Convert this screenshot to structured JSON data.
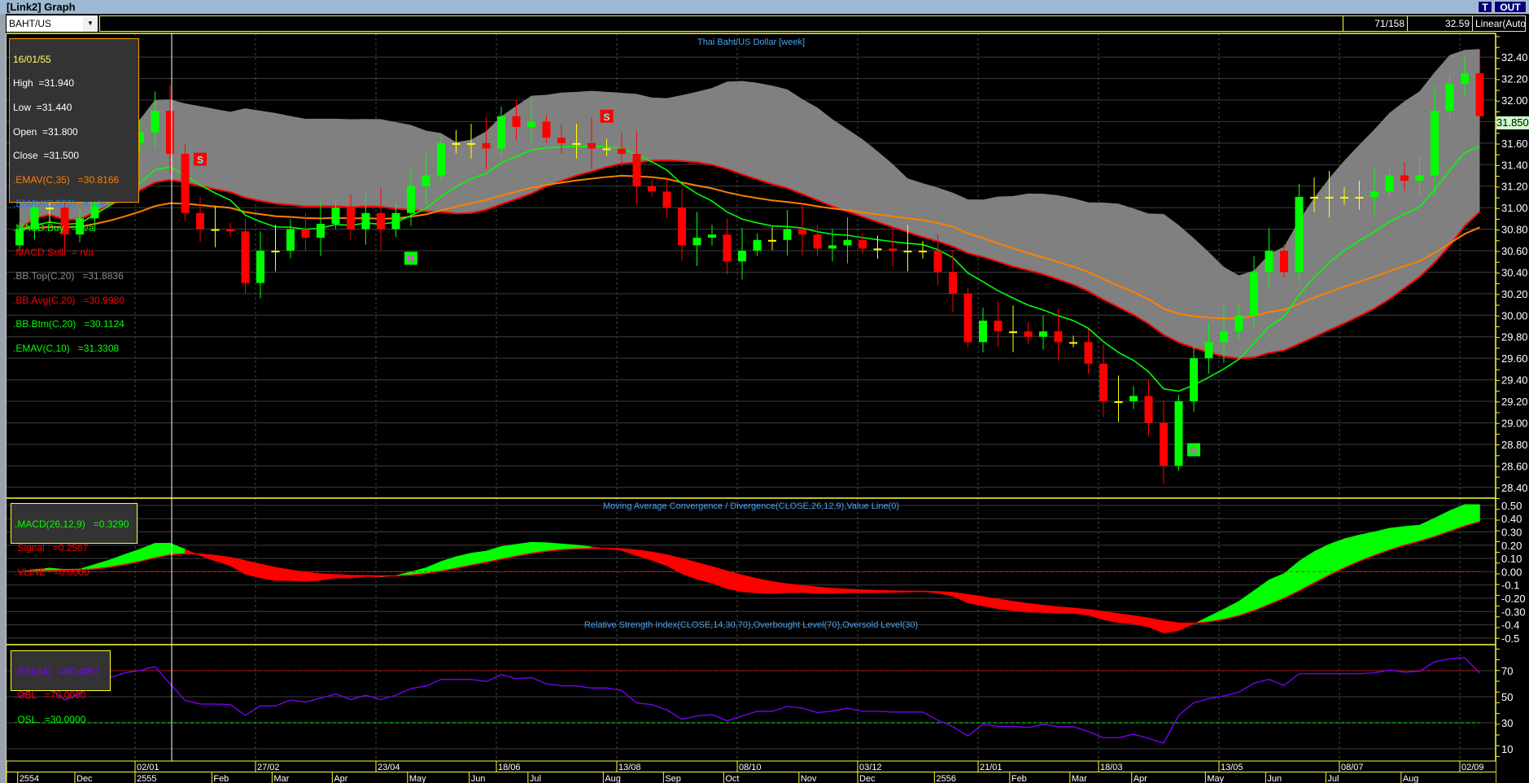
{
  "window": {
    "title": "[Link2] Graph",
    "t_button": "T",
    "out_button": "OUT"
  },
  "toolbar": {
    "symbol": "BAHT/US",
    "bar_count": "71/158",
    "last_value": "32.59",
    "scale_mode": "Linear(Auto"
  },
  "price_pane": {
    "title": "Thai Baht/US Dollar [week]",
    "current_price_label": "31.850",
    "legend": {
      "date": "16/01/55",
      "high": "High  =31.940",
      "low": "Low  =31.440",
      "open": "Open  =31.800",
      "close": "Close  =31.500",
      "emav35": ".EMAV(C,35)   =30.8166",
      "emav200": ".EMAV(C,200)   = n/a",
      "macd_buy": ".MACD.Buy   = n/a",
      "macd_sell": ".MACD.Sell   = n/a",
      "bb_top": ".BB.Top(C,20)   =31.8836",
      "bb_avg": ".BB.Avg(C,20)   =30.9980",
      "bb_btm": ".BB.Btm(C,20)   =30.1124",
      "emav10": ".EMAV(C,10)   =31.3308"
    }
  },
  "macd_pane": {
    "title": "Moving Average Convergence / Divergence(CLOSE,26,12,9),Value Line(0)",
    "legend": {
      "macd": ".MACD(26,12,9)   =0.3290",
      "signal": ".Signal   =0.2567",
      "vline": ".VLINE   =0.0000"
    }
  },
  "rsi_pane": {
    "title": "Relative Strength Index(CLOSE,14,30,70),Overbought Level(70),Oversold Level(30)",
    "legend": {
      "rsi": ".RSI(14)   =60.4057",
      "obl": ".OBL   =70.0000",
      "osl": ".OSL   =30.0000"
    }
  },
  "colors": {
    "up": "#00ff00",
    "down": "#ff0000",
    "doji": "#ffff00",
    "bb_fill": "#808080",
    "ema10": "#00ff00",
    "ema35": "#ff8000",
    "bb_avg": "#ff0000",
    "rsi": "#8000ff",
    "axis": "#ffff33",
    "title": "#4aa0f0"
  },
  "chart_data": {
    "type": "candlestick",
    "interval": "week",
    "cursor_index": 10,
    "first_open": 30.65,
    "closes": [
      30.8,
      31.0,
      31.0,
      30.75,
      30.9,
      31.3,
      31.4,
      31.6,
      31.7,
      31.9,
      31.5,
      30.95,
      30.8,
      30.8,
      30.78,
      30.3,
      30.6,
      30.6,
      30.8,
      30.72,
      30.85,
      31.0,
      30.8,
      30.95,
      30.8,
      30.95,
      31.2,
      31.3,
      31.6,
      31.6,
      31.6,
      31.55,
      31.85,
      31.75,
      31.8,
      31.65,
      31.6,
      31.6,
      31.55,
      31.55,
      31.5,
      31.2,
      31.15,
      31.0,
      30.65,
      30.72,
      30.75,
      30.5,
      30.6,
      30.7,
      30.7,
      30.8,
      30.75,
      30.62,
      30.65,
      30.7,
      30.62,
      30.62,
      30.6,
      30.6,
      30.6,
      30.4,
      30.2,
      29.75,
      29.95,
      29.85,
      29.85,
      29.8,
      29.85,
      29.75,
      29.75,
      29.55,
      29.2,
      29.2,
      29.25,
      29.0,
      28.6,
      29.2,
      29.6,
      29.75,
      29.85,
      30.0,
      30.4,
      30.6,
      30.4,
      31.1,
      31.1,
      31.1,
      31.1,
      31.1,
      31.15,
      31.3,
      31.25,
      31.3,
      31.9,
      32.15,
      32.25,
      31.85
    ],
    "cursor_candle": {
      "open": 31.8,
      "high": 31.94,
      "low": 31.44,
      "close": 31.5
    },
    "signals": [
      {
        "index": 12,
        "type": "S",
        "price": 31.45
      },
      {
        "index": 26,
        "type": "B",
        "price": 30.53
      },
      {
        "index": 39,
        "type": "S",
        "price": 31.85
      },
      {
        "index": 78,
        "type": "B",
        "price": 28.75
      }
    ],
    "price_axis": {
      "min": 28.3,
      "max": 32.62,
      "ticks": [
        "28.40",
        "28.60",
        "28.80",
        "29.00",
        "29.20",
        "29.40",
        "29.60",
        "29.80",
        "30.00",
        "30.20",
        "30.40",
        "30.60",
        "30.80",
        "31.00",
        "31.20",
        "31.40",
        "31.60",
        "31.80",
        "32.00",
        "32.20",
        "32.40"
      ]
    },
    "macd_axis": {
      "min": -0.55,
      "max": 0.555,
      "ticks": [
        "0.50",
        "0.40",
        "0.30",
        "0.20",
        "0.10",
        "0.00",
        "-0.1",
        "-0.20",
        "-0.30",
        "-0.4",
        "-0.5"
      ],
      "tick_values": [
        0.5,
        0.4,
        0.3,
        0.2,
        0.1,
        0,
        -0.1,
        -0.2,
        -0.3,
        -0.4,
        -0.5
      ]
    },
    "rsi_axis": {
      "min": 0.6,
      "max": 90,
      "ticks": [
        "70",
        "50",
        "30",
        "10"
      ],
      "tick_values": [
        70,
        50,
        30,
        10
      ],
      "overbought": 70,
      "oversold": 30
    },
    "date_labels": [
      {
        "label": "02/01",
        "week": 8
      },
      {
        "label": "27/02",
        "week": 16
      },
      {
        "label": "23/04",
        "week": 24
      },
      {
        "label": "18/06",
        "week": 32
      },
      {
        "label": "13/08",
        "week": 40
      },
      {
        "label": "08/10",
        "week": 48
      },
      {
        "label": "03/12",
        "week": 56
      },
      {
        "label": "21/01",
        "week": 64
      },
      {
        "label": "18/03",
        "week": 72
      },
      {
        "label": "13/05",
        "week": 80
      },
      {
        "label": "08/07",
        "week": 88
      },
      {
        "label": "02/09",
        "week": 96
      }
    ],
    "month_labels": [
      {
        "label": "2554",
        "week": 0.2
      },
      {
        "label": "Dec",
        "week": 4
      },
      {
        "label": "2555",
        "week": 8
      },
      {
        "label": "Feb",
        "week": 13.1
      },
      {
        "label": "Mar",
        "week": 17.1
      },
      {
        "label": "Apr",
        "week": 21.1
      },
      {
        "label": "May",
        "week": 26.1
      },
      {
        "label": "Jun",
        "week": 30.2
      },
      {
        "label": "Jul",
        "week": 34.1
      },
      {
        "label": "Aug",
        "week": 39.1
      },
      {
        "label": "Sep",
        "week": 43.1
      },
      {
        "label": "Oct",
        "week": 47.1
      },
      {
        "label": "Nov",
        "week": 52.1
      },
      {
        "label": "Dec",
        "week": 56
      },
      {
        "label": "2556",
        "week": 61.1
      },
      {
        "label": "Feb",
        "week": 66.1
      },
      {
        "label": "Mar",
        "week": 70.1
      },
      {
        "label": "Apr",
        "week": 74.2
      },
      {
        "label": "May",
        "week": 79.1
      },
      {
        "label": "Jun",
        "week": 83.1
      },
      {
        "label": "Jul",
        "week": 87.1
      },
      {
        "label": "Aug",
        "week": 92.1
      }
    ]
  }
}
